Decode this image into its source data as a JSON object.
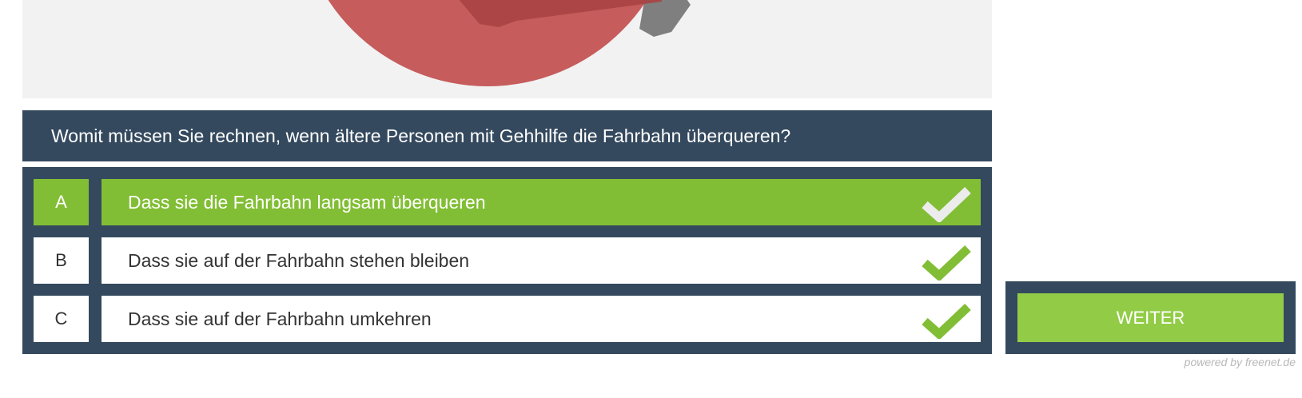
{
  "question": {
    "text": "Womit müssen Sie rechnen, wenn ältere Personen mit Gehhilfe die Fahrbahn überqueren?"
  },
  "answers": [
    {
      "letter": "A",
      "text": "Dass sie die Fahrbahn langsam überqueren",
      "selected": true,
      "icon": "check-icon"
    },
    {
      "letter": "B",
      "text": "Dass sie auf der Fahrbahn stehen bleiben",
      "selected": false,
      "icon": "check-icon"
    },
    {
      "letter": "C",
      "text": "Dass sie auf der Fahrbahn umkehren",
      "selected": false,
      "icon": "check-icon"
    }
  ],
  "weiter": {
    "label": "WEITER"
  },
  "footer": {
    "powered_by": "powered by freenet.de"
  },
  "colors": {
    "panel_dark": "#34495e",
    "selected_green": "#82be35",
    "button_green": "#92cc47",
    "check_green": "#82be35",
    "check_white": "#ececec",
    "sign_red": "#c65c5c",
    "image_background": "#f2f2f2"
  }
}
